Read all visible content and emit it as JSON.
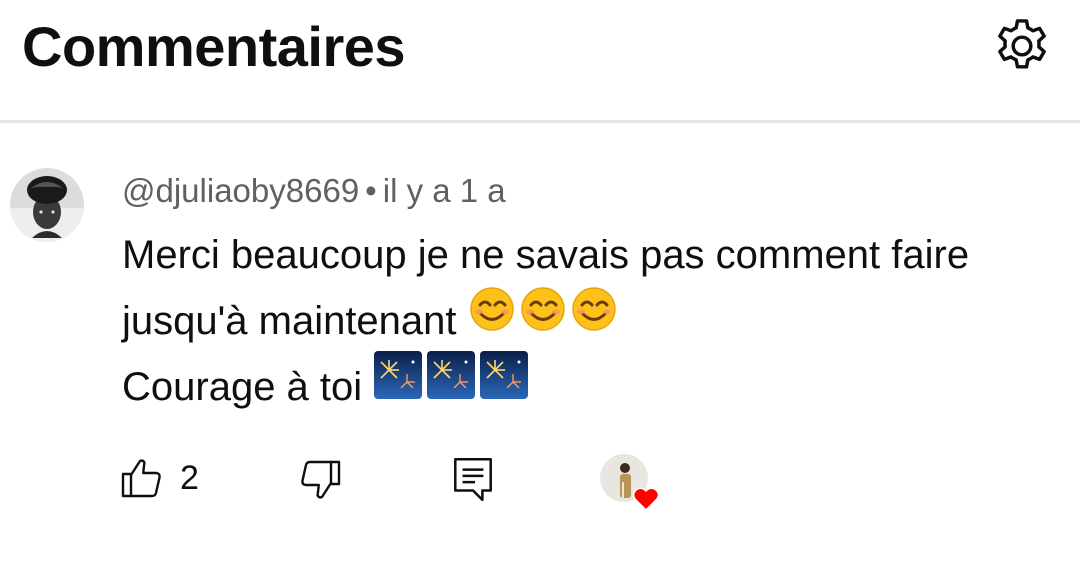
{
  "header": {
    "title": "Commentaires",
    "settings_icon": "gear-icon"
  },
  "comment": {
    "author": "@djuliaoby8669",
    "separator": "•",
    "time": "il y a 1 a",
    "lines": [
      "Merci beaucoup je ne savais pas comment faire",
      "jusqu'à maintenant",
      "Courage à toi"
    ],
    "emoji_smile": "smiling-face-emoji",
    "emoji_fireworks": "fireworks-emoji",
    "likes": "2",
    "creator_heart": true,
    "heart_color": "#ff0000"
  },
  "actions": {
    "like_icon": "thumbs-up-icon",
    "dislike_icon": "thumbs-down-icon",
    "reply_icon": "reply-comment-icon"
  }
}
